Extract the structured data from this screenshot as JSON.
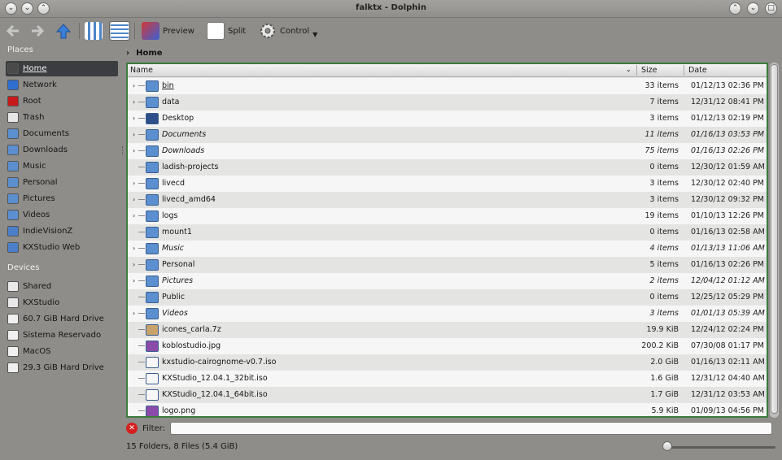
{
  "window": {
    "title": "falktx - Dolphin"
  },
  "titlebar": {
    "left_buttons": [
      "chevron-down-icon",
      "chevron-down-icon",
      "chevron-up-icon"
    ],
    "right_buttons": [
      "keep-above-icon",
      "minimize-icon",
      "maximize-icon"
    ]
  },
  "toolbar": {
    "preview_label": "Preview",
    "split_label": "Split",
    "control_label": "Control"
  },
  "places": {
    "places_header": "Places",
    "items": [
      {
        "label": "Home",
        "icon": "home-icon",
        "selected": true
      },
      {
        "label": "Network",
        "icon": "network-icon"
      },
      {
        "label": "Root",
        "icon": "root-folder-icon"
      },
      {
        "label": "Trash",
        "icon": "trash-icon"
      },
      {
        "label": "Documents",
        "icon": "documents-folder-icon"
      },
      {
        "label": "Downloads",
        "icon": "downloads-folder-icon"
      },
      {
        "label": "Music",
        "icon": "music-folder-icon"
      },
      {
        "label": "Personal",
        "icon": "personal-folder-icon"
      },
      {
        "label": "Pictures",
        "icon": "pictures-folder-icon"
      },
      {
        "label": "Videos",
        "icon": "videos-folder-icon"
      },
      {
        "label": "IndieVisionZ",
        "icon": "web-folder-icon"
      },
      {
        "label": "KXStudio Web",
        "icon": "web-folder-icon"
      }
    ],
    "devices_header": "Devices",
    "devices": [
      {
        "label": "Shared",
        "icon": "drive-icon"
      },
      {
        "label": "KXStudio",
        "icon": "drive-icon"
      },
      {
        "label": "60.7 GiB Hard Drive",
        "icon": "hard-drive-icon"
      },
      {
        "label": "Sistema Reservado",
        "icon": "hard-drive-icon"
      },
      {
        "label": "MacOS",
        "icon": "hard-drive-icon"
      },
      {
        "label": "29.3 GiB Hard Drive",
        "icon": "hard-drive-icon"
      }
    ]
  },
  "breadcrumb": {
    "path": "Home"
  },
  "columns": {
    "name": "Name",
    "size": "Size",
    "date": "Date"
  },
  "files": [
    {
      "name": "bin",
      "size": "33 items",
      "date": "01/12/13 02:36 PM",
      "expandable": true,
      "underline": true,
      "italic": false,
      "icon": "folder-icon"
    },
    {
      "name": "data",
      "size": "7 items",
      "date": "12/31/12 08:41 PM",
      "expandable": true,
      "italic": false,
      "icon": "folder-icon"
    },
    {
      "name": "Desktop",
      "size": "3 items",
      "date": "01/12/13 02:19 PM",
      "expandable": true,
      "italic": false,
      "icon": "desktop-folder-icon"
    },
    {
      "name": "Documents",
      "size": "11 items",
      "date": "01/16/13 03:53 PM",
      "expandable": true,
      "italic": true,
      "icon": "documents-folder-icon"
    },
    {
      "name": "Downloads",
      "size": "75 items",
      "date": "01/16/13 02:26 PM",
      "expandable": true,
      "italic": true,
      "icon": "downloads-folder-icon"
    },
    {
      "name": "ladish-projects",
      "size": "0 items",
      "date": "12/30/12 01:59 AM",
      "expandable": false,
      "italic": false,
      "icon": "folder-icon"
    },
    {
      "name": "livecd",
      "size": "3 items",
      "date": "12/30/12 02:40 PM",
      "expandable": true,
      "italic": false,
      "icon": "folder-icon"
    },
    {
      "name": "livecd_amd64",
      "size": "3 items",
      "date": "12/30/12 09:32 PM",
      "expandable": true,
      "italic": false,
      "icon": "folder-icon"
    },
    {
      "name": "logs",
      "size": "19 items",
      "date": "01/10/13 12:26 PM",
      "expandable": true,
      "italic": false,
      "icon": "folder-icon"
    },
    {
      "name": "mount1",
      "size": "0 items",
      "date": "01/16/13 02:58 AM",
      "expandable": false,
      "italic": false,
      "icon": "folder-icon"
    },
    {
      "name": "Music",
      "size": "4 items",
      "date": "01/13/13 11:06 AM",
      "expandable": true,
      "italic": true,
      "icon": "music-folder-icon"
    },
    {
      "name": "Personal",
      "size": "5 items",
      "date": "01/16/13 02:26 PM",
      "expandable": true,
      "italic": false,
      "icon": "personal-folder-icon"
    },
    {
      "name": "Pictures",
      "size": "2 items",
      "date": "12/04/12 01:12 AM",
      "expandable": true,
      "italic": true,
      "icon": "pictures-folder-icon"
    },
    {
      "name": "Public",
      "size": "0 items",
      "date": "12/25/12 05:29 PM",
      "expandable": false,
      "italic": false,
      "icon": "folder-icon"
    },
    {
      "name": "Videos",
      "size": "3 items",
      "date": "01/01/13 05:39 AM",
      "expandable": true,
      "italic": true,
      "icon": "videos-folder-icon"
    },
    {
      "name": "icones_carla.7z",
      "size": "19.9 KiB",
      "date": "12/24/12 02:24 PM",
      "expandable": false,
      "italic": false,
      "icon": "archive-icon"
    },
    {
      "name": "koblostudio.jpg",
      "size": "200.2 KiB",
      "date": "07/30/08 01:17 PM",
      "expandable": false,
      "italic": false,
      "icon": "image-file-icon"
    },
    {
      "name": "kxstudio-cairognome-v0.7.iso",
      "size": "2.0 GiB",
      "date": "01/16/13 02:11 AM",
      "expandable": false,
      "italic": false,
      "icon": "iso-file-icon"
    },
    {
      "name": "KXStudio_12.04.1_32bit.iso",
      "size": "1.6 GiB",
      "date": "12/31/12 04:40 AM",
      "expandable": false,
      "italic": false,
      "icon": "iso-file-icon"
    },
    {
      "name": "KXStudio_12.04.1_64bit.iso",
      "size": "1.7 GiB",
      "date": "12/31/12 03:53 AM",
      "expandable": false,
      "italic": false,
      "icon": "iso-file-icon"
    },
    {
      "name": "logo.png",
      "size": "5.9 KiB",
      "date": "01/09/13 04:56 PM",
      "expandable": false,
      "italic": false,
      "icon": "image-file-icon"
    }
  ],
  "filter": {
    "label": "Filter:",
    "value": ""
  },
  "status": {
    "summary": "15 Folders, 8 Files (5.4 GiB)"
  },
  "colors": {
    "accent": "#3d7a3d",
    "selection": "#3b3d40",
    "folder": "#5b8fd0"
  }
}
